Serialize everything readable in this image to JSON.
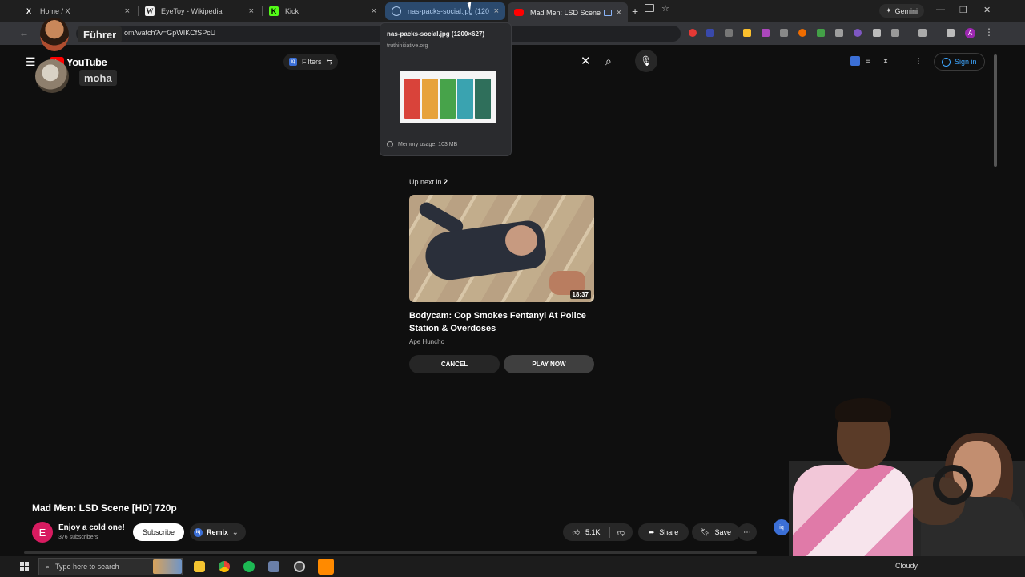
{
  "browser": {
    "tabs": [
      {
        "title": "Home / X",
        "favicon": "x-icon"
      },
      {
        "title": "EyeToy - Wikipedia",
        "favicon": "wikipedia-icon"
      },
      {
        "title": "Kick",
        "favicon": "kick-icon"
      },
      {
        "title": "nas-packs-social.jpg (1200×627)",
        "favicon": "globe-icon"
      },
      {
        "title": "Mad Men: LSD Scene [HD]",
        "favicon": "youtube-icon"
      }
    ],
    "gemini_label": "Gemini",
    "url": "om/watch?v=GpWIKCfSPcU",
    "profile_initial": "A"
  },
  "hover_card": {
    "title": "nas-packs-social.jpg (1200×627)",
    "domain": "truthinitiative.org",
    "memory": "Memory usage: 103 MB"
  },
  "overlay": {
    "tag1": "Führer",
    "tag2": "moha"
  },
  "youtube": {
    "logo_text": "YouTube",
    "filters_label": "Filters",
    "signin_label": "Sign in"
  },
  "up_next": {
    "label_prefix": "Up next in ",
    "countdown": "2",
    "duration": "18:37",
    "title": "Bodycam: Cop Smokes Fentanyl At Police Station & Overdoses",
    "channel": "Ape Huncho",
    "cancel_label": "CANCEL",
    "play_label": "PLAY NOW"
  },
  "video": {
    "title": "Mad Men: LSD Scene [HD] 720p",
    "channel_initial": "E",
    "channel_name": "Enjoy a cold one!",
    "subscribers": "376 subscribers",
    "subscribe_label": "Subscribe",
    "remix_label": "Remix",
    "likes": "5.1K",
    "share_label": "Share",
    "save_label": "Save"
  },
  "taskbar": {
    "search_placeholder": "Type here to search",
    "weather": "Cloudy"
  },
  "colors": {
    "youtube_red": "#ff0000",
    "link_blue": "#3ea6ff",
    "background": "#0f0f0f"
  }
}
